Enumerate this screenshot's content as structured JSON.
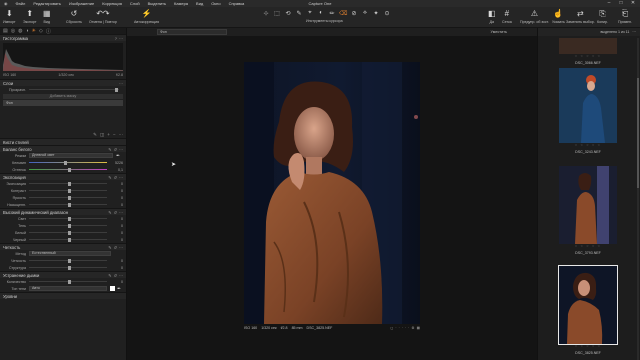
{
  "menu": {
    "items": [
      "Файл",
      "Редактировать",
      "Изображение",
      "Коррекция",
      "Слой",
      "Выделить",
      "Камера",
      "Вид",
      "Окно",
      "Справка"
    ],
    "app_title": "Capture One",
    "window_controls": [
      "–",
      "□",
      "✕"
    ]
  },
  "toolbar": {
    "import": "Импорт",
    "export": "Экспорт",
    "view": "Вид",
    "reset": "Сбросить",
    "undo_redo": "Отмена | Повтор",
    "auto": "Автокоррекция",
    "cursor_tools_label": "Инструменты курсора",
    "right_buttons": [
      "Да",
      "Сетка",
      "Предупр. об экст.",
      "Указать",
      "Заменить выбор.",
      "Копир.",
      "Примен."
    ],
    "cursor_tools": [
      "⊹",
      "⬚",
      "⟲",
      "✎",
      "⌖",
      "◐",
      "✏",
      "⌫",
      "⊘",
      "⟡",
      "✦",
      "⊙"
    ]
  },
  "left_panel": {
    "histogram": {
      "title": "Гистограмма",
      "iso": "ISO 160",
      "shutter": "1/320 сек",
      "aperture": "f/2.8"
    },
    "layers": {
      "title": "Слои",
      "opacity_label": "Прозрачн.",
      "add_mask_button": "Добавить маску",
      "background_layer": "Фон"
    },
    "style_brushes": "Кисти стилей",
    "white_balance": {
      "title": "Баланс белого",
      "mode_label": "Режим",
      "mode_value": "Дневной свет",
      "kelvin_label": "Кельвин",
      "kelvin_value": "5226",
      "tint_label": "Оттенок",
      "tint_value": "0,1"
    },
    "exposure": {
      "title": "Экспозиция",
      "rows": [
        {
          "label": "Экспозиция",
          "value": "0"
        },
        {
          "label": "Контраст",
          "value": "0"
        },
        {
          "label": "Яркость",
          "value": "0"
        },
        {
          "label": "Насыщенн.",
          "value": "0"
        }
      ]
    },
    "hdr": {
      "title": "Высокий динамический диапазон",
      "rows": [
        {
          "label": "Свет",
          "value": "0"
        },
        {
          "label": "Тень",
          "value": "0"
        },
        {
          "label": "Белый",
          "value": "0"
        },
        {
          "label": "Черный",
          "value": "0"
        }
      ]
    },
    "clarity": {
      "title": "Четкость",
      "method_label": "Метод",
      "method_value": "Естественный",
      "rows": [
        {
          "label": "Четкость",
          "value": "0"
        },
        {
          "label": "Структура",
          "value": "0"
        }
      ]
    },
    "dehaze": {
      "title": "Устранение дымки",
      "amount_label": "Количество",
      "amount_value": "0",
      "tone_label": "Тон тени",
      "tone_value": "Авто"
    },
    "levels": "Уровни"
  },
  "viewer": {
    "layer_select": "Фон",
    "fit_label": "Уместить",
    "meta": {
      "iso": "ISO 160",
      "shutter": "1/320 сек",
      "aperture": "f/2.8",
      "focal": "85 mm",
      "filename": "DSC_3825.NEF"
    }
  },
  "browser": {
    "selection": "выделено 1 из 11",
    "thumbnails": [
      {
        "name": "DSC_3066.NEF"
      },
      {
        "name": "DSC_3243.NEF"
      },
      {
        "name": "DSC_3793.NEF"
      },
      {
        "name": "DSC_3825.NEF",
        "selected": true
      }
    ],
    "stars": "☆ ☆ ☆ ☆ ☆"
  },
  "colors": {
    "accent": "#e08030",
    "panel_bg": "#202020",
    "viewer_bg": "#141414"
  }
}
